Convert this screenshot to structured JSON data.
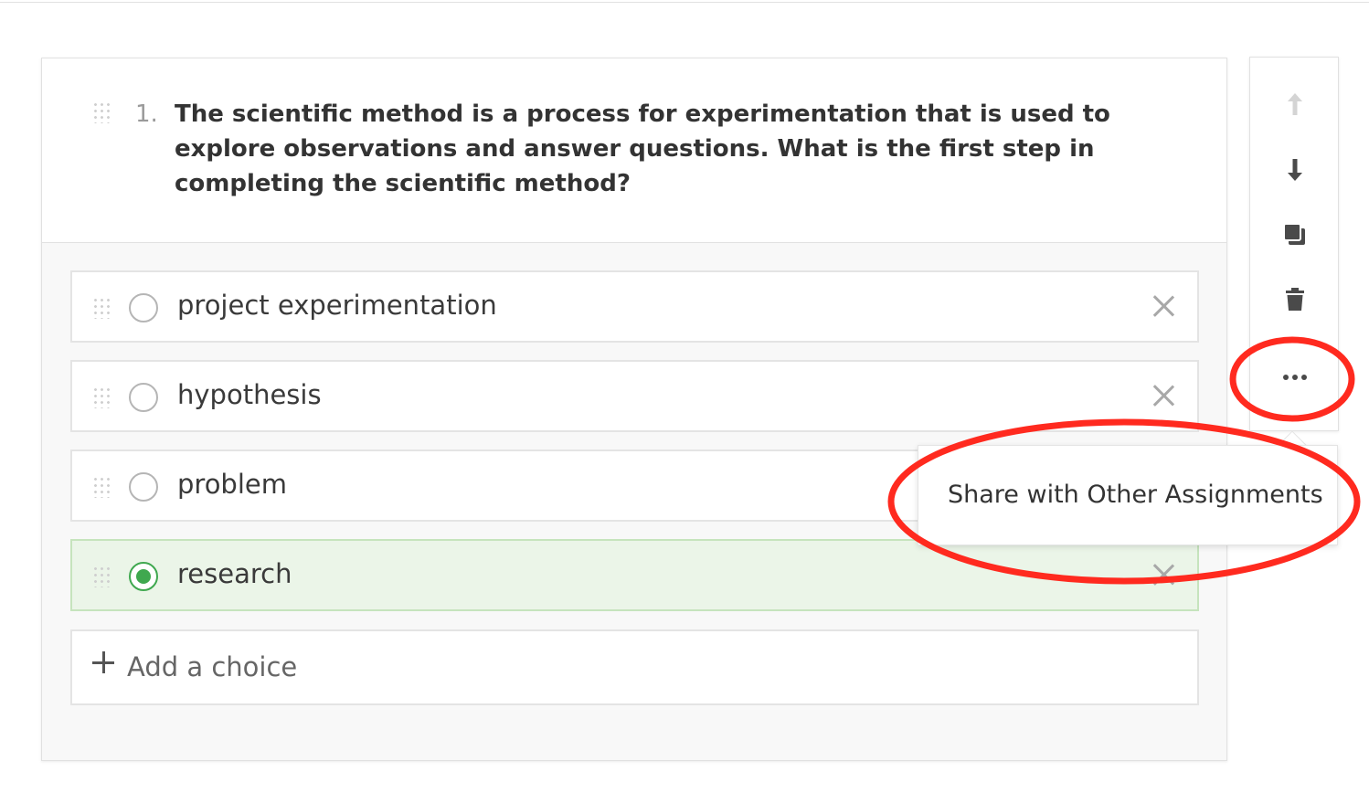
{
  "question": {
    "number": "1.",
    "text": "The scientific method is a process for experimentation that is used to explore observations and answer questions. What is the first step in completing the scientific method?"
  },
  "choices": [
    {
      "label": "project experimentation",
      "correct": false
    },
    {
      "label": "hypothesis",
      "correct": false
    },
    {
      "label": "problem",
      "correct": false
    },
    {
      "label": "research",
      "correct": true
    }
  ],
  "add_choice_label": "Add a choice",
  "toolbar": {
    "items": [
      "arrow-up-icon",
      "arrow-down-icon",
      "duplicate-icon",
      "trash-icon",
      "more-icon"
    ]
  },
  "menu": {
    "items": [
      "Share with Other Assignments"
    ]
  },
  "colors": {
    "correct": "#3fa84f",
    "correct_bg": "#ebf5e8",
    "annotation": "#ff2a1f"
  }
}
